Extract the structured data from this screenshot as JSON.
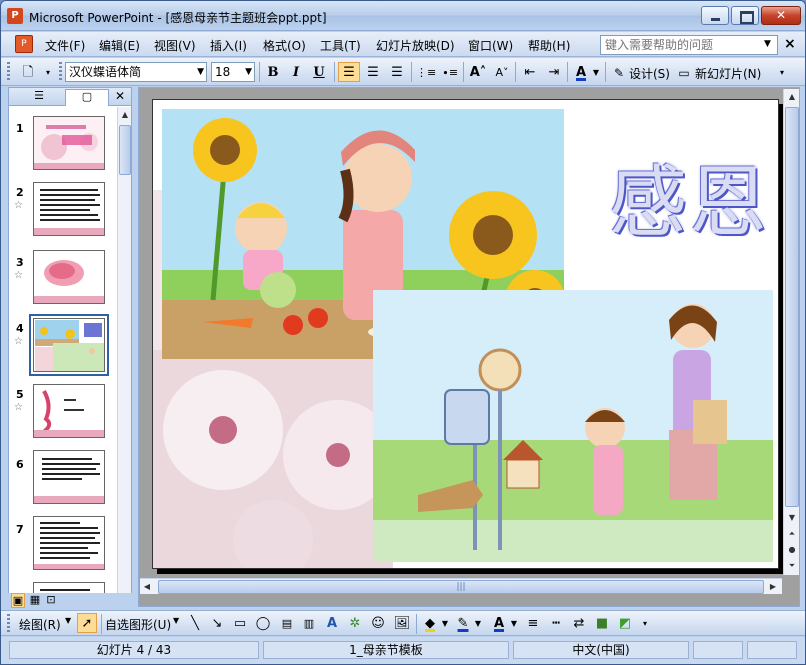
{
  "window": {
    "title": "Microsoft PowerPoint - [感恩母亲节主题班会ppt.ppt]"
  },
  "menu": {
    "items": [
      "文件(F)",
      "编辑(E)",
      "视图(V)",
      "插入(I)",
      "格式(O)",
      "工具(T)",
      "幻灯片放映(D)",
      "窗口(W)",
      "帮助(H)"
    ],
    "help_placeholder": "键入需要帮助的问题"
  },
  "toolbar": {
    "font_name": "汉仪蝶语体简",
    "font_size": "18",
    "bold": "B",
    "italic": "I",
    "underline": "U",
    "design_label": "设计(S)",
    "new_slide_label": "新幻灯片(N)"
  },
  "slides_panel": {
    "thumbnails": [
      {
        "num": "1"
      },
      {
        "num": "2"
      },
      {
        "num": "3"
      },
      {
        "num": "4",
        "active": true
      },
      {
        "num": "5"
      },
      {
        "num": "6"
      },
      {
        "num": "7"
      }
    ]
  },
  "slide": {
    "title": "感恩"
  },
  "drawbar": {
    "draw_label": "绘图(R)",
    "autoshape_label": "自选图形(U)"
  },
  "status": {
    "slide_pos": "幻灯片 4 / 43",
    "template": "1_母亲节模板",
    "language": "中文(中国)"
  },
  "colors": {
    "accent": "#315ea5",
    "title_outline": "#4e57c8"
  }
}
